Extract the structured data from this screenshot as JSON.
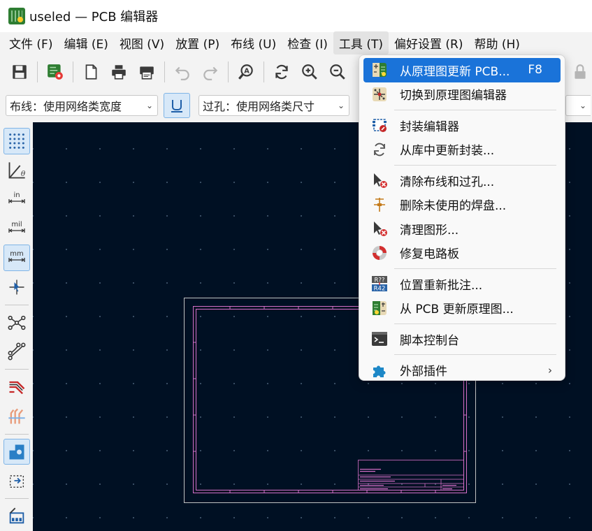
{
  "window": {
    "title": "useled — PCB 编辑器"
  },
  "menubar": {
    "items": [
      "文件 (F)",
      "编辑 (E)",
      "视图 (V)",
      "放置 (P)",
      "布线 (U)",
      "检查 (I)",
      "工具 (T)",
      "偏好设置 (R)",
      "帮助 (H)"
    ],
    "active": "工具 (T)"
  },
  "toolbar2": {
    "track_width": "布线：使用网络类宽度",
    "via_size": "过孔：使用网络类尺寸"
  },
  "left_toolbar": {
    "units_in": "in",
    "units_mil": "mil",
    "units_mm": "mm"
  },
  "tools_menu": {
    "items": [
      {
        "label": "从原理图更新 PCB...",
        "shortcut": "F8",
        "icon": "update-pcb-icon",
        "highlighted": true
      },
      {
        "label": "切换到原理图编辑器",
        "icon": "schematic-editor-icon"
      },
      {
        "label": "封装编辑器",
        "icon": "footprint-editor-icon"
      },
      {
        "label": "从库中更新封装...",
        "icon": "refresh-icon"
      },
      {
        "label": "清除布线和过孔...",
        "icon": "delete-cursor-icon"
      },
      {
        "label": "删除未使用的焊盘...",
        "icon": "unused-pads-icon"
      },
      {
        "label": "清理图形...",
        "icon": "cleanup-graphics-icon"
      },
      {
        "label": "修复电路板",
        "icon": "repair-icon"
      },
      {
        "label": "位置重新批注...",
        "icon": "annotate-icon",
        "icon_text_top": "R??",
        "icon_text_bottom": "R42"
      },
      {
        "label": "从 PCB 更新原理图...",
        "icon": "update-schematic-icon"
      },
      {
        "label": "脚本控制台",
        "icon": "console-icon"
      },
      {
        "label": "外部插件",
        "icon": "puzzle-icon",
        "submenu": true
      }
    ]
  },
  "colors": {
    "canvas_bg": "#001023",
    "sheet_border": "#c2c2c2",
    "sheet_frame": "#d76fc8",
    "highlight": "#1a73d9"
  }
}
